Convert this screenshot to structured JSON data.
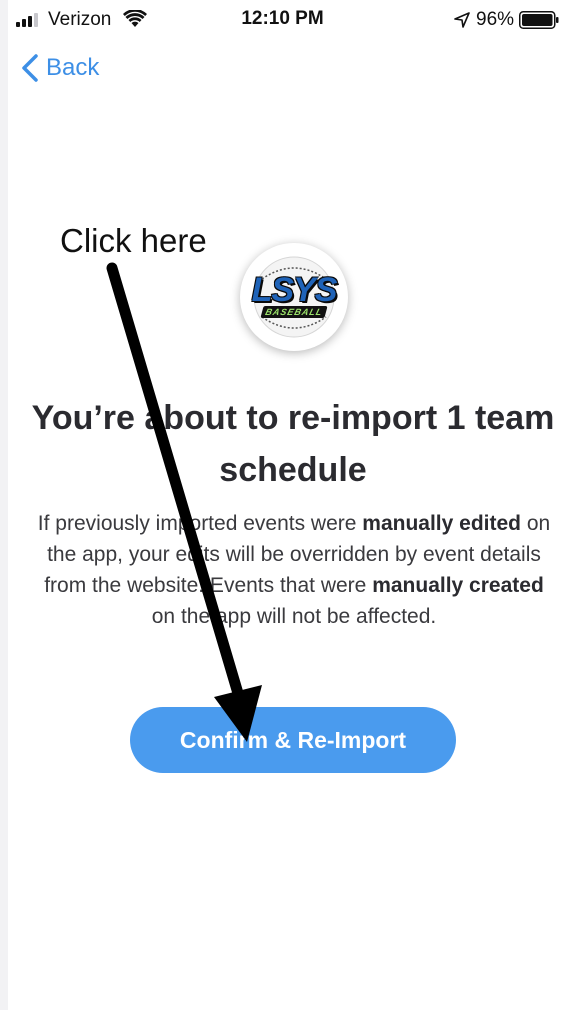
{
  "status_bar": {
    "carrier": "Verizon",
    "time": "12:10 PM",
    "battery_percent": "96%"
  },
  "nav": {
    "back_label": "Back"
  },
  "annotation": {
    "text": "Click here"
  },
  "logo": {
    "text": "LSYS",
    "subtext": "BASEBALL"
  },
  "content": {
    "heading": "You’re about to re-import 1 team schedule",
    "body_1": "If previously imported events were ",
    "body_bold_1": "manually edited",
    "body_2": " on the app, your edits will be overridden by event details from the website. Events that were ",
    "body_bold_2": "manually created",
    "body_3": " on the app will not be affected."
  },
  "actions": {
    "confirm_label": "Confirm & Re-Import"
  },
  "colors": {
    "accent": "#3d8fe6",
    "button": "#4a9bee",
    "text": "#2b2b30"
  }
}
